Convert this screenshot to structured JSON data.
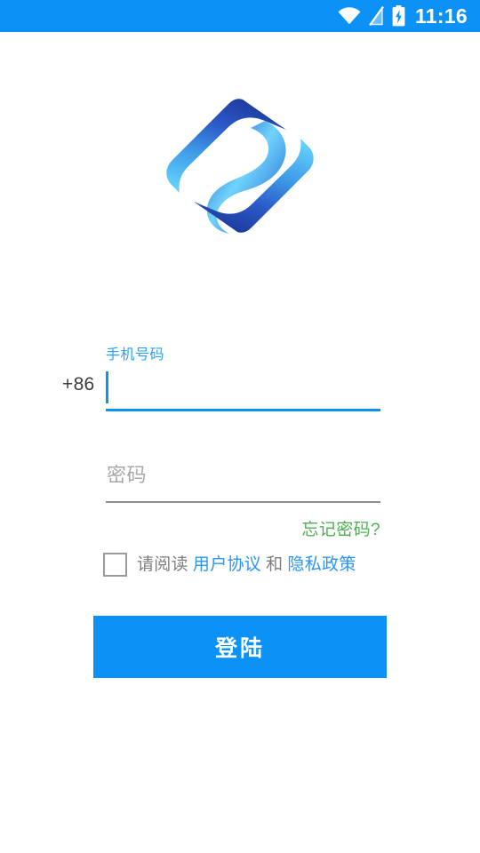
{
  "theme": {
    "primary_blue": "#0C92F7",
    "link_blue": "#2B95F5",
    "label_blue": "#29A0F7",
    "green": "#4CAF50",
    "text_gray": "#7E7E7E",
    "placeholder_gray": "#A8A8A8",
    "dark_text": "#3C3C3C",
    "logo_dark": "#1E3C9E",
    "logo_light": "#4FC3F7",
    "background": "#FFFFFF"
  },
  "statusbar": {
    "time": "11:16",
    "icons": [
      "wifi-icon",
      "signal-off-icon",
      "battery-charging-icon"
    ]
  },
  "logo": {
    "name": "app-logo",
    "shape": "abstract-diamond-swirl"
  },
  "form": {
    "phone": {
      "label": "手机号码",
      "country_code": "+86",
      "value": "",
      "placeholder": "",
      "focused": true
    },
    "password": {
      "label": "密码",
      "value": "",
      "placeholder": "密码",
      "focused": false
    },
    "forgot_password": "忘记密码?",
    "agreement": {
      "checked": false,
      "prefix": "请阅读",
      "terms_link": "用户协议",
      "conjunction": "和",
      "privacy_link": "隐私政策"
    },
    "submit_label": "登陆"
  }
}
